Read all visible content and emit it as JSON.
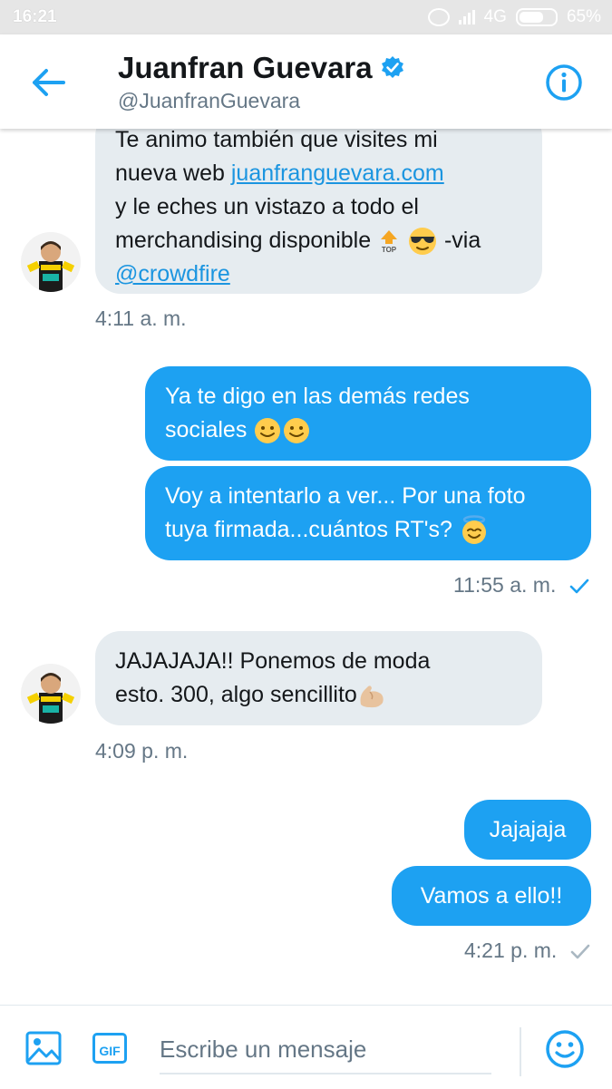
{
  "status_bar": {
    "time": "16:21",
    "network": "4G",
    "battery": "65%"
  },
  "header": {
    "name": "Juanfran Guevara",
    "handle": "@JuanfranGuevara",
    "verified_icon": "verified-badge-icon",
    "back_icon": "arrow-left-icon",
    "info_icon": "info-icon"
  },
  "messages": [
    {
      "direction": "incoming",
      "lines": [
        "Te animo también que visites mi",
        "nueva web ",
        "juanfranguevara.com",
        "y le eches un vistazo a todo el",
        "merchandising disponible",
        "-via",
        "@crowdfire"
      ],
      "timestamp": "4:11 a. m."
    },
    {
      "direction": "outgoing",
      "text_1": "Ya te digo en las demás redes",
      "text_2": "sociales"
    },
    {
      "direction": "outgoing",
      "text_1": "Voy a intentarlo a ver... Por una foto",
      "text_2": "tuya firmada...cuántos RT's?",
      "timestamp": "11:55 a. m."
    },
    {
      "direction": "incoming",
      "text_1": "JAJAJAJA!! Ponemos de moda",
      "text_2": "esto. 300, algo sencillito",
      "timestamp": "4:09 p. m."
    },
    {
      "direction": "outgoing",
      "text": "Jajajaja"
    },
    {
      "direction": "outgoing",
      "text": "Vamos a ello!!",
      "timestamp": "4:21 p. m."
    }
  ],
  "composer": {
    "placeholder": "Escribe un mensaje",
    "gif_label": "GIF",
    "photo_icon": "photo-icon",
    "emoji_icon": "smiley-icon"
  },
  "colors": {
    "accent": "#1da1f2",
    "incoming_bubble": "#e6ecf0",
    "meta_text": "#657786"
  }
}
